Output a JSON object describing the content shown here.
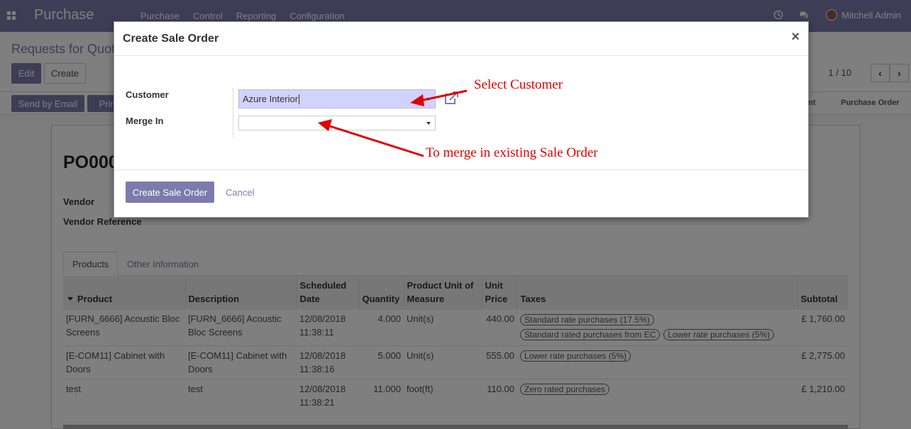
{
  "navbar": {
    "app_title": "Purchase",
    "menu": [
      "Purchase",
      "Control",
      "Reporting",
      "Configuration"
    ],
    "user_name": "Mitchell Admin"
  },
  "control": {
    "breadcrumb": "Requests for Quotation",
    "edit_label": "Edit",
    "create_label": "Create",
    "send_email_label": "Send by Email",
    "print_label": "Print",
    "pager": "1 / 10"
  },
  "statusbar": {
    "steps": [
      "ent",
      "Purchase Order"
    ]
  },
  "form": {
    "name": "PO000",
    "vendor_label": "Vendor",
    "vendor_ref_label": "Vendor Reference",
    "tabs": [
      "Products",
      "Other Information"
    ],
    "columns": [
      "Product",
      "Description",
      "Scheduled Date",
      "Quantity",
      "Product Unit of Measure",
      "Unit Price",
      "Taxes",
      "Subtotal"
    ],
    "rows": [
      {
        "product": "[FURN_6666] Acoustic Bloc Screens",
        "description": "[FURN_6666] Acoustic Bloc Screens",
        "date": "12/08/2018 11:38:11",
        "qty": "4.000",
        "uom": "Unit(s)",
        "price": "440.00",
        "taxes": [
          "Standard rate purchases (17.5%)",
          "Standard rated purchases from EC",
          "Lower rate purchases (5%)"
        ],
        "subtotal": "£ 1,760.00"
      },
      {
        "product": "[E-COM11] Cabinet with Doors",
        "description": "[E-COM11] Cabinet with Doors",
        "date": "12/08/2018 11:38:16",
        "qty": "5.000",
        "uom": "Unit(s)",
        "price": "555.00",
        "taxes": [
          "Lower rate purchases (5%)"
        ],
        "subtotal": "£ 2,775.00"
      },
      {
        "product": "test",
        "description": "test",
        "date": "12/08/2018 11:38:21",
        "qty": "11.000",
        "uom": "foot(ft)",
        "price": "110.00",
        "taxes": [
          "Zero rated purchases"
        ],
        "subtotal": "£ 1,210.00"
      }
    ]
  },
  "modal": {
    "title": "Create Sale Order",
    "close": "×",
    "customer_label": "Customer",
    "customer_value": "Azure Interior",
    "merge_label": "Merge In",
    "merge_value": "",
    "submit_label": "Create Sale Order",
    "cancel_label": "Cancel"
  },
  "annotations": {
    "select_customer": "Select Customer",
    "merge_note": "To merge in existing Sale Order"
  },
  "colors": {
    "brand": "#7c7bad",
    "annotation": "#e00000",
    "customer_field": "#d2d2ff"
  }
}
